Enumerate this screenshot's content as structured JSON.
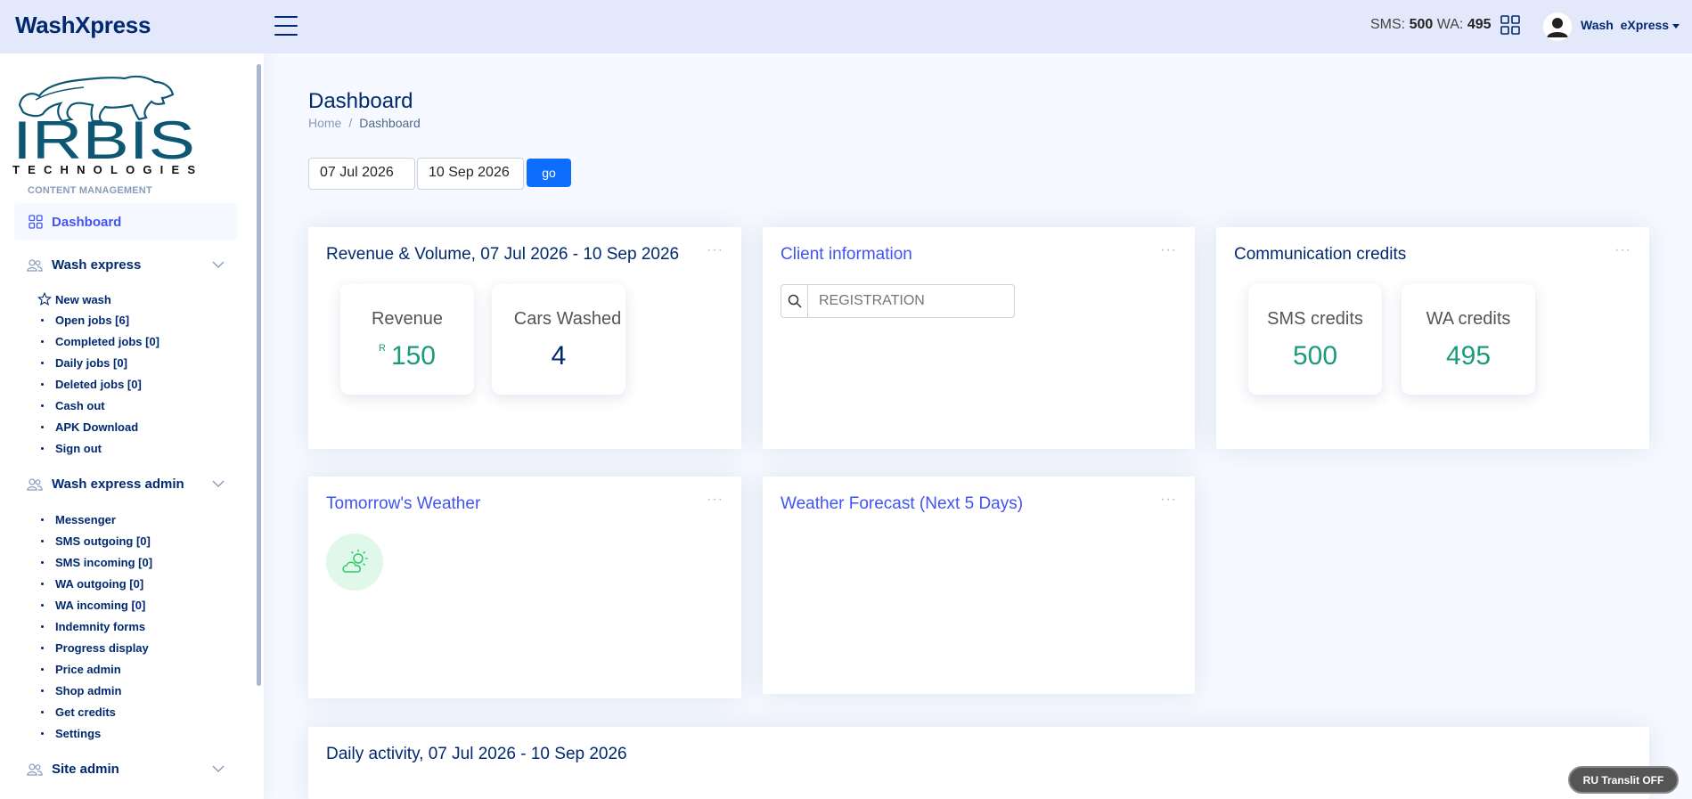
{
  "header": {
    "app_name": "WashXpress",
    "sms_label": "SMS:",
    "sms_value": "500",
    "wa_label": "WA:",
    "wa_value": "495",
    "user_name": "Wash  eXpress"
  },
  "sidebar": {
    "brand_name": "IRBIS",
    "brand_sub": "TECHNOLOGIES",
    "section_heading": "CONTENT MANAGEMENT",
    "dashboard_label": "Dashboard",
    "groups": [
      {
        "label": "Wash express",
        "items": [
          "New wash",
          "Open jobs [6]",
          "Completed jobs [0]",
          "Daily jobs [0]",
          "Deleted jobs [0]",
          "Cash out",
          "APK Download",
          "Sign out"
        ]
      },
      {
        "label": "Wash express admin",
        "items": [
          "Messenger",
          "SMS outgoing [0]",
          "SMS incoming [0]",
          "WA outgoing [0]",
          "WA incoming [0]",
          "Indemnity forms",
          "Progress display",
          "Price admin",
          "Shop admin",
          "Get credits",
          "Settings"
        ]
      },
      {
        "label": "Site admin",
        "items": []
      }
    ],
    "colors": {
      "accent": "#4154f1",
      "text": "#012970"
    }
  },
  "main": {
    "page_title": "Dashboard",
    "breadcrumb": [
      "Home",
      "Dashboard"
    ],
    "date_from": "07 Jul 2026",
    "date_to": "10 Sep 2026",
    "go_label": "go",
    "cards": {
      "revenue": {
        "title": "Revenue & Volume, 07 Jul 2026 - 10 Sep 2026",
        "revenue_label": "Revenue",
        "currency": "R",
        "revenue_value": "150",
        "cars_label": "Cars Washed",
        "cars_value": "4"
      },
      "client": {
        "title": "Client information",
        "search_placeholder": "REGISTRATION"
      },
      "comm": {
        "title": "Communication credits",
        "sms_label": "SMS credits",
        "sms_value": "500",
        "wa_label": "WA credits",
        "wa_value": "495"
      },
      "weather": {
        "title": "Tomorrow's Weather",
        "icon": "partly-cloudy-icon"
      },
      "forecast": {
        "title": "Weather Forecast (Next 5 Days)"
      },
      "daily": {
        "title": "Daily activity, 07 Jul 2026 - 10 Sep 2026"
      }
    },
    "more_glyph": "···"
  },
  "translit": {
    "label": "RU Translit OFF"
  }
}
